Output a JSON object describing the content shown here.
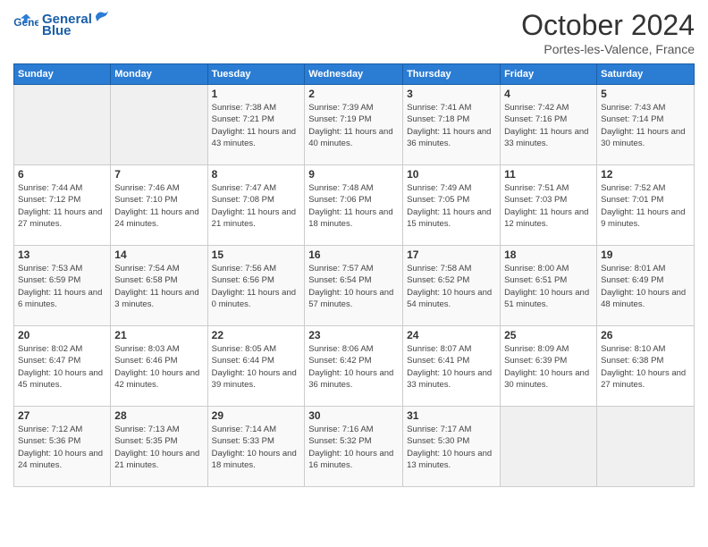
{
  "logo": {
    "text_general": "General",
    "text_blue": "Blue"
  },
  "header": {
    "title": "October 2024",
    "location": "Portes-les-Valence, France"
  },
  "weekdays": [
    "Sunday",
    "Monday",
    "Tuesday",
    "Wednesday",
    "Thursday",
    "Friday",
    "Saturday"
  ],
  "weeks": [
    [
      {
        "day": "",
        "sunrise": "",
        "sunset": "",
        "daylight": ""
      },
      {
        "day": "",
        "sunrise": "",
        "sunset": "",
        "daylight": ""
      },
      {
        "day": "1",
        "sunrise": "Sunrise: 7:38 AM",
        "sunset": "Sunset: 7:21 PM",
        "daylight": "Daylight: 11 hours and 43 minutes."
      },
      {
        "day": "2",
        "sunrise": "Sunrise: 7:39 AM",
        "sunset": "Sunset: 7:19 PM",
        "daylight": "Daylight: 11 hours and 40 minutes."
      },
      {
        "day": "3",
        "sunrise": "Sunrise: 7:41 AM",
        "sunset": "Sunset: 7:18 PM",
        "daylight": "Daylight: 11 hours and 36 minutes."
      },
      {
        "day": "4",
        "sunrise": "Sunrise: 7:42 AM",
        "sunset": "Sunset: 7:16 PM",
        "daylight": "Daylight: 11 hours and 33 minutes."
      },
      {
        "day": "5",
        "sunrise": "Sunrise: 7:43 AM",
        "sunset": "Sunset: 7:14 PM",
        "daylight": "Daylight: 11 hours and 30 minutes."
      }
    ],
    [
      {
        "day": "6",
        "sunrise": "Sunrise: 7:44 AM",
        "sunset": "Sunset: 7:12 PM",
        "daylight": "Daylight: 11 hours and 27 minutes."
      },
      {
        "day": "7",
        "sunrise": "Sunrise: 7:46 AM",
        "sunset": "Sunset: 7:10 PM",
        "daylight": "Daylight: 11 hours and 24 minutes."
      },
      {
        "day": "8",
        "sunrise": "Sunrise: 7:47 AM",
        "sunset": "Sunset: 7:08 PM",
        "daylight": "Daylight: 11 hours and 21 minutes."
      },
      {
        "day": "9",
        "sunrise": "Sunrise: 7:48 AM",
        "sunset": "Sunset: 7:06 PM",
        "daylight": "Daylight: 11 hours and 18 minutes."
      },
      {
        "day": "10",
        "sunrise": "Sunrise: 7:49 AM",
        "sunset": "Sunset: 7:05 PM",
        "daylight": "Daylight: 11 hours and 15 minutes."
      },
      {
        "day": "11",
        "sunrise": "Sunrise: 7:51 AM",
        "sunset": "Sunset: 7:03 PM",
        "daylight": "Daylight: 11 hours and 12 minutes."
      },
      {
        "day": "12",
        "sunrise": "Sunrise: 7:52 AM",
        "sunset": "Sunset: 7:01 PM",
        "daylight": "Daylight: 11 hours and 9 minutes."
      }
    ],
    [
      {
        "day": "13",
        "sunrise": "Sunrise: 7:53 AM",
        "sunset": "Sunset: 6:59 PM",
        "daylight": "Daylight: 11 hours and 6 minutes."
      },
      {
        "day": "14",
        "sunrise": "Sunrise: 7:54 AM",
        "sunset": "Sunset: 6:58 PM",
        "daylight": "Daylight: 11 hours and 3 minutes."
      },
      {
        "day": "15",
        "sunrise": "Sunrise: 7:56 AM",
        "sunset": "Sunset: 6:56 PM",
        "daylight": "Daylight: 11 hours and 0 minutes."
      },
      {
        "day": "16",
        "sunrise": "Sunrise: 7:57 AM",
        "sunset": "Sunset: 6:54 PM",
        "daylight": "Daylight: 10 hours and 57 minutes."
      },
      {
        "day": "17",
        "sunrise": "Sunrise: 7:58 AM",
        "sunset": "Sunset: 6:52 PM",
        "daylight": "Daylight: 10 hours and 54 minutes."
      },
      {
        "day": "18",
        "sunrise": "Sunrise: 8:00 AM",
        "sunset": "Sunset: 6:51 PM",
        "daylight": "Daylight: 10 hours and 51 minutes."
      },
      {
        "day": "19",
        "sunrise": "Sunrise: 8:01 AM",
        "sunset": "Sunset: 6:49 PM",
        "daylight": "Daylight: 10 hours and 48 minutes."
      }
    ],
    [
      {
        "day": "20",
        "sunrise": "Sunrise: 8:02 AM",
        "sunset": "Sunset: 6:47 PM",
        "daylight": "Daylight: 10 hours and 45 minutes."
      },
      {
        "day": "21",
        "sunrise": "Sunrise: 8:03 AM",
        "sunset": "Sunset: 6:46 PM",
        "daylight": "Daylight: 10 hours and 42 minutes."
      },
      {
        "day": "22",
        "sunrise": "Sunrise: 8:05 AM",
        "sunset": "Sunset: 6:44 PM",
        "daylight": "Daylight: 10 hours and 39 minutes."
      },
      {
        "day": "23",
        "sunrise": "Sunrise: 8:06 AM",
        "sunset": "Sunset: 6:42 PM",
        "daylight": "Daylight: 10 hours and 36 minutes."
      },
      {
        "day": "24",
        "sunrise": "Sunrise: 8:07 AM",
        "sunset": "Sunset: 6:41 PM",
        "daylight": "Daylight: 10 hours and 33 minutes."
      },
      {
        "day": "25",
        "sunrise": "Sunrise: 8:09 AM",
        "sunset": "Sunset: 6:39 PM",
        "daylight": "Daylight: 10 hours and 30 minutes."
      },
      {
        "day": "26",
        "sunrise": "Sunrise: 8:10 AM",
        "sunset": "Sunset: 6:38 PM",
        "daylight": "Daylight: 10 hours and 27 minutes."
      }
    ],
    [
      {
        "day": "27",
        "sunrise": "Sunrise: 7:12 AM",
        "sunset": "Sunset: 5:36 PM",
        "daylight": "Daylight: 10 hours and 24 minutes."
      },
      {
        "day": "28",
        "sunrise": "Sunrise: 7:13 AM",
        "sunset": "Sunset: 5:35 PM",
        "daylight": "Daylight: 10 hours and 21 minutes."
      },
      {
        "day": "29",
        "sunrise": "Sunrise: 7:14 AM",
        "sunset": "Sunset: 5:33 PM",
        "daylight": "Daylight: 10 hours and 18 minutes."
      },
      {
        "day": "30",
        "sunrise": "Sunrise: 7:16 AM",
        "sunset": "Sunset: 5:32 PM",
        "daylight": "Daylight: 10 hours and 16 minutes."
      },
      {
        "day": "31",
        "sunrise": "Sunrise: 7:17 AM",
        "sunset": "Sunset: 5:30 PM",
        "daylight": "Daylight: 10 hours and 13 minutes."
      },
      {
        "day": "",
        "sunrise": "",
        "sunset": "",
        "daylight": ""
      },
      {
        "day": "",
        "sunrise": "",
        "sunset": "",
        "daylight": ""
      }
    ]
  ]
}
